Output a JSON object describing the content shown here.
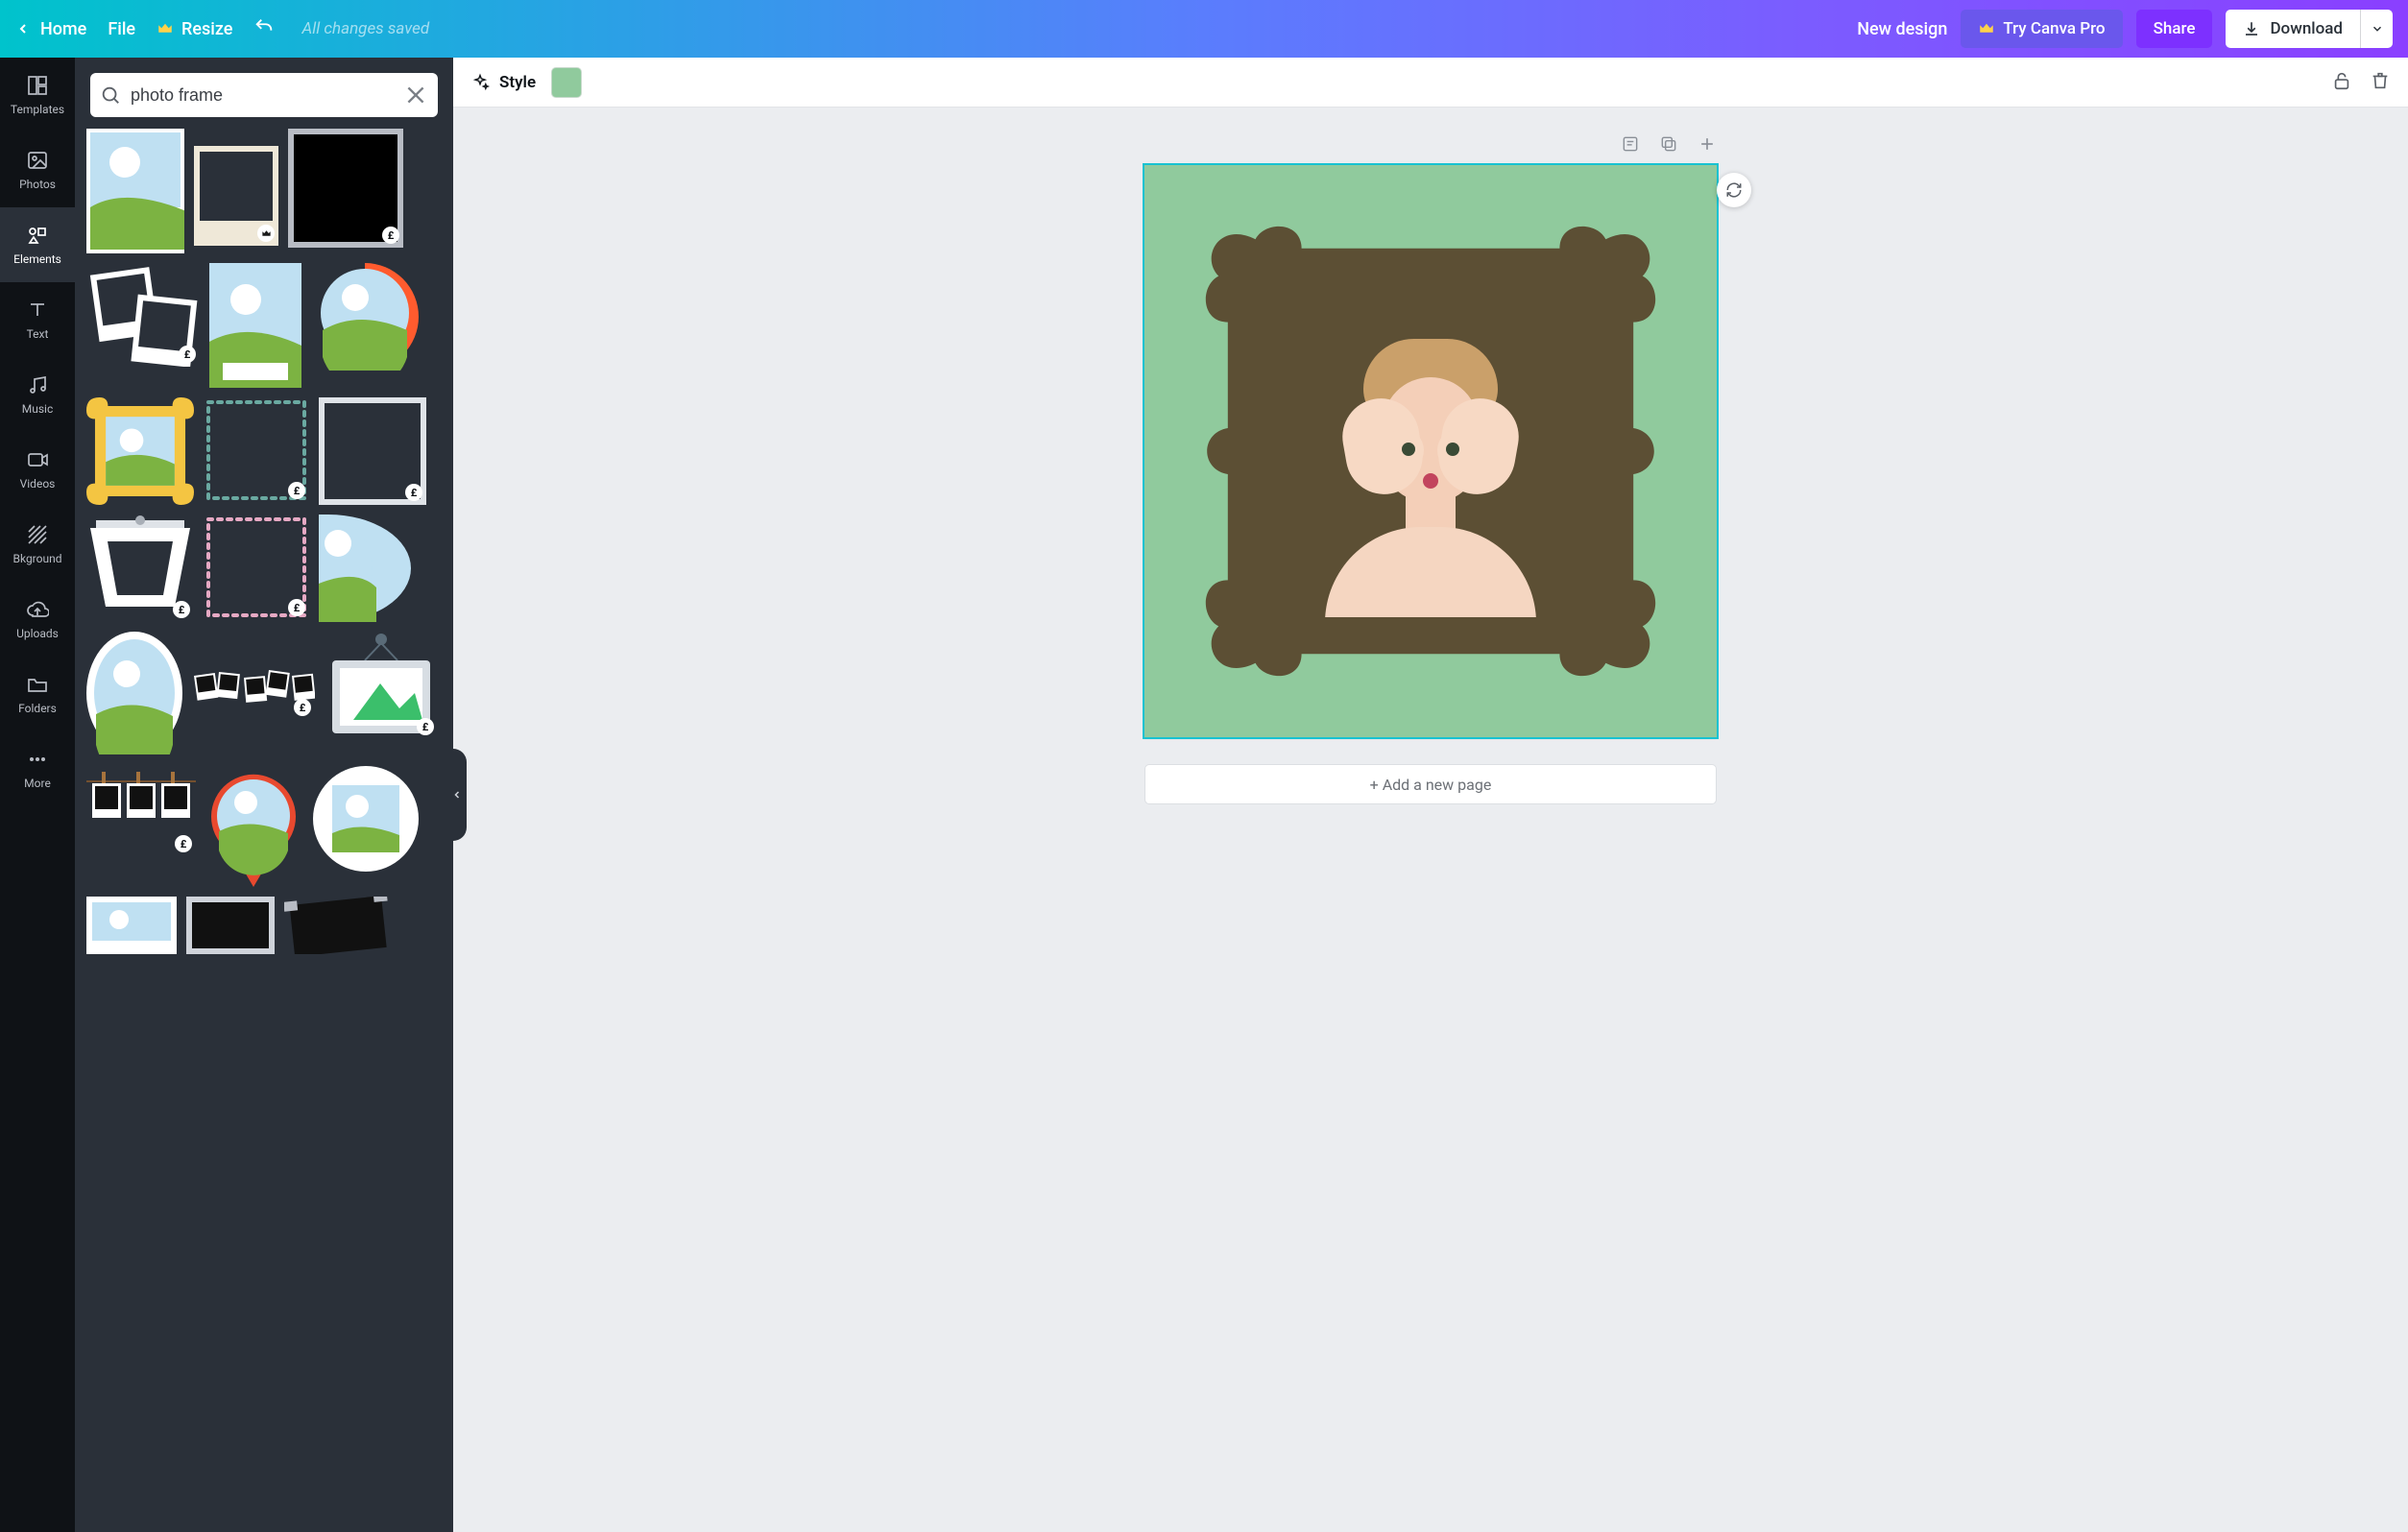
{
  "topbar": {
    "home": "Home",
    "file": "File",
    "resize": "Resize",
    "saved_msg": "All changes saved",
    "new_design": "New design",
    "try_pro": "Try Canva Pro",
    "share": "Share",
    "download": "Download"
  },
  "rail": {
    "items": [
      {
        "id": "templates",
        "label": "Templates"
      },
      {
        "id": "photos",
        "label": "Photos"
      },
      {
        "id": "elements",
        "label": "Elements"
      },
      {
        "id": "text",
        "label": "Text"
      },
      {
        "id": "music",
        "label": "Music"
      },
      {
        "id": "videos",
        "label": "Videos"
      },
      {
        "id": "bkground",
        "label": "Bkground"
      },
      {
        "id": "uploads",
        "label": "Uploads"
      },
      {
        "id": "folders",
        "label": "Folders"
      },
      {
        "id": "more",
        "label": "More"
      }
    ],
    "active": "elements"
  },
  "search": {
    "placeholder": "Search",
    "query": "photo frame"
  },
  "results": {
    "currency_badge": "£",
    "pro_badge": "crown"
  },
  "editor": {
    "style_label": "Style",
    "swatch_color": "#90ca9d",
    "add_page": "+ Add a new page"
  }
}
